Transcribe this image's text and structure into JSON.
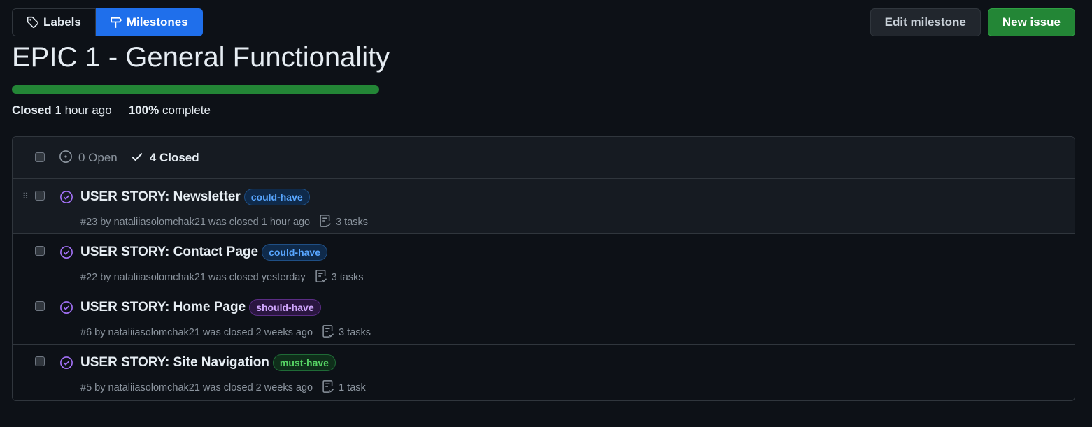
{
  "subnav": {
    "labels_tab": "Labels",
    "milestones_tab": "Milestones"
  },
  "actions": {
    "edit_milestone": "Edit milestone",
    "new_issue": "New issue"
  },
  "milestone": {
    "title": "EPIC 1 - General Functionality",
    "progress_percent": 100,
    "status": "Closed",
    "status_time": "1 hour ago",
    "complete_pct": "100%",
    "complete_label": "complete"
  },
  "filter": {
    "open_label": "0 Open",
    "closed_label": "4 Closed"
  },
  "colors": {
    "accent": "#1f6feb",
    "success": "#238636",
    "closed_issue": "#a371f7"
  },
  "issues": [
    {
      "title": "USER STORY: Newsletter",
      "label": "could-have",
      "label_fg": "#58a6ff",
      "label_bg": "#0f2a4a",
      "label_border": "#1f4f85",
      "meta": "#23 by nataliiasolomchak21 was closed 1 hour ago",
      "tasks": "3 tasks"
    },
    {
      "title": "USER STORY: Contact Page",
      "label": "could-have",
      "label_fg": "#58a6ff",
      "label_bg": "#0f2a4a",
      "label_border": "#1f4f85",
      "meta": "#22 by nataliiasolomchak21 was closed yesterday",
      "tasks": "3 tasks"
    },
    {
      "title": "USER STORY: Home Page",
      "label": "should-have",
      "label_fg": "#d2a8ff",
      "label_bg": "#2a1640",
      "label_border": "#5b2d85",
      "meta": "#6 by nataliiasolomchak21 was closed 2 weeks ago",
      "tasks": "3 tasks"
    },
    {
      "title": "USER STORY: Site Navigation",
      "label": "must-have",
      "label_fg": "#56d364",
      "label_bg": "#0f2e1a",
      "label_border": "#1f6b36",
      "meta": "#5 by nataliiasolomchak21 was closed 2 weeks ago",
      "tasks": "1 task"
    }
  ]
}
